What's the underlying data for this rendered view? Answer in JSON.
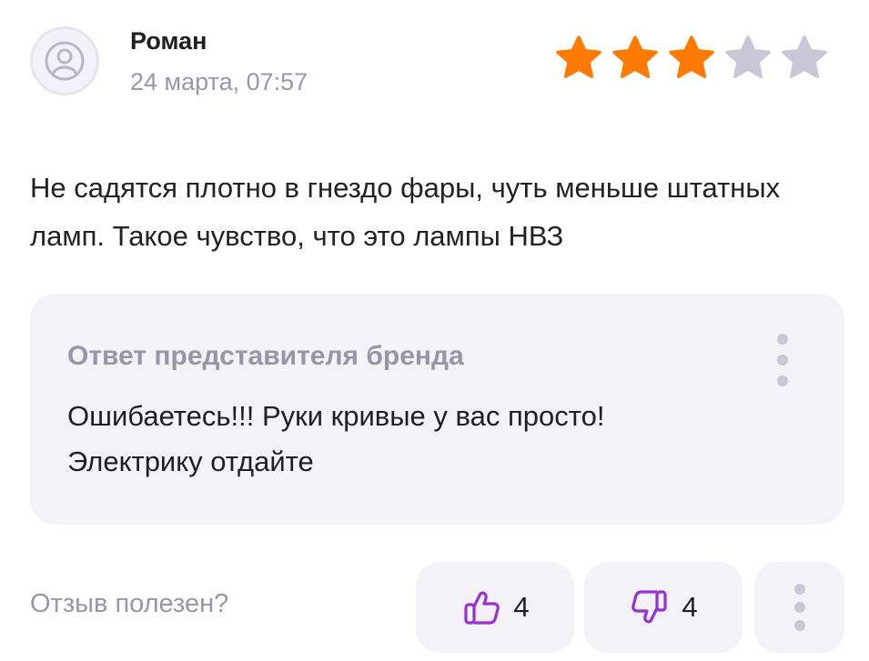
{
  "review": {
    "author": "Роман",
    "date": "24 марта, 07:57",
    "rating": 3,
    "rating_max": 5,
    "text": "Не садятся плотно в гнездо фары, чуть меньше штатных ламп. Такое чувство, что это лампы НВЗ"
  },
  "reply": {
    "title": "Ответ представителя бренда",
    "text": "Ошибаетесь!!! Руки кривые у вас просто! Электрику отдайте"
  },
  "feedback": {
    "question": "Отзыв полезен?",
    "likes": "4",
    "dislikes": "4"
  },
  "colors": {
    "star_filled": "#ff7a00",
    "star_empty": "#c9c6d6",
    "accent_icon": "#9b2fd6",
    "panel_bg": "#f3f2f7",
    "muted_text": "#9896a6"
  },
  "icons": {
    "avatar": "user-icon",
    "star": "star-icon",
    "like": "thumbs-up-icon",
    "dislike": "thumbs-down-icon",
    "more": "more-vertical-icon"
  }
}
